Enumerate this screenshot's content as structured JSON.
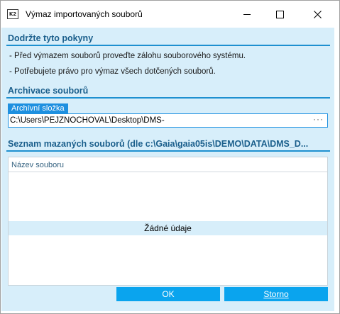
{
  "window": {
    "title": "Výmaz importovaných souborů",
    "icon_text": "K2"
  },
  "instructions": {
    "heading": "Dodržte tyto pokyny",
    "lines": [
      "- Před výmazem souborů proveďte zálohu souborového systému.",
      "- Potřebujete právo pro výmaz všech dotčených souborů."
    ]
  },
  "archive": {
    "heading": "Archivace souborů",
    "field_label": "Archívní složka",
    "field_value": "C:\\Users\\PEJZNOCHOVAL\\Desktop\\DMS-",
    "browse_label": "···"
  },
  "list": {
    "heading": "Seznam mazaných souborů (dle c:\\Gaia\\gaia05is\\DEMO\\DATA\\DMS_D...",
    "column_header": "Název souboru",
    "empty_text": "Žádné údaje"
  },
  "buttons": {
    "ok_label": "OK",
    "cancel_label": "Storno"
  },
  "colors": {
    "panel_background": "#d7eefa",
    "accent": "#1e90d0",
    "button": "#0aa4ee"
  }
}
